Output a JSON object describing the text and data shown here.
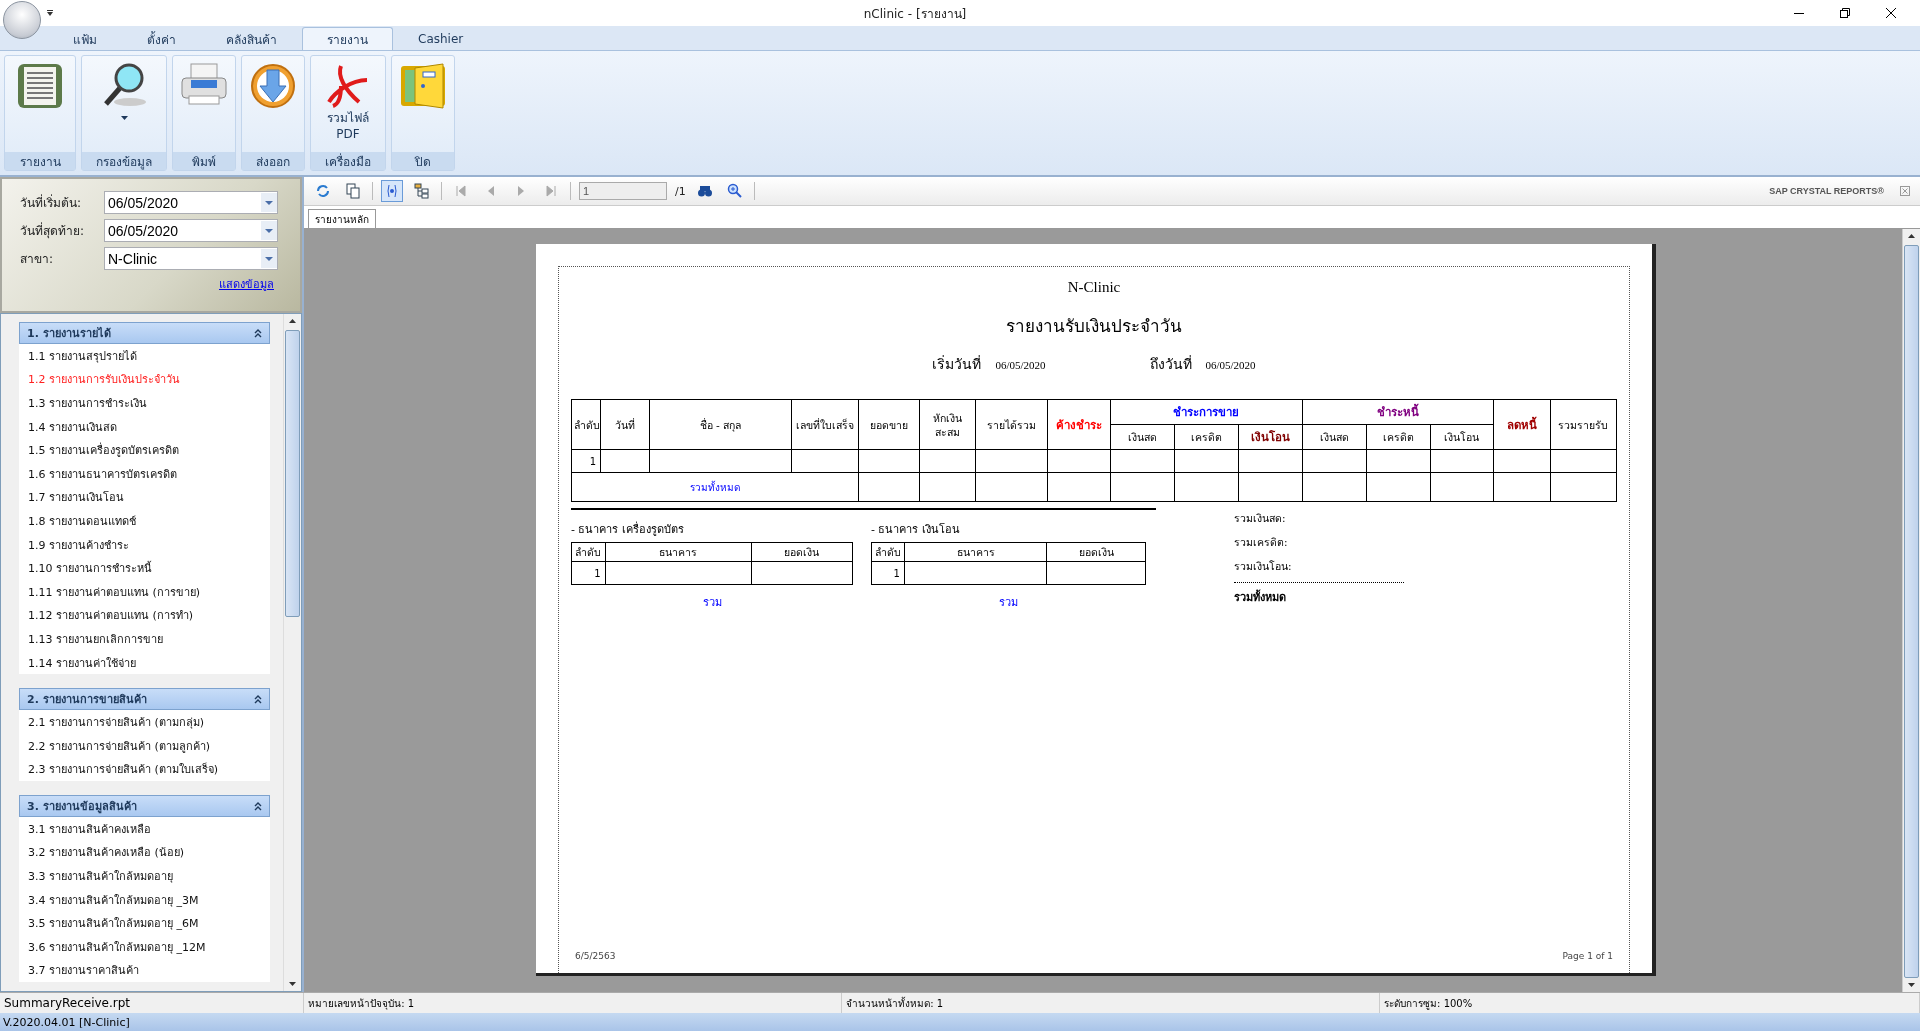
{
  "window": {
    "title": "nClinic - [รายงาน]"
  },
  "ribbon_tabs": [
    {
      "label": "แฟ้ม",
      "selected": false
    },
    {
      "label": "ตั้งค่า",
      "selected": false
    },
    {
      "label": "คลังสินค้า",
      "selected": false
    },
    {
      "label": "รายงาน",
      "selected": true
    },
    {
      "label": "Cashier",
      "selected": false
    }
  ],
  "ribbon_groups": [
    {
      "label": "รายงาน",
      "kind": "report"
    },
    {
      "label": "กรองข้อมูล",
      "kind": "magnifier",
      "dropdown": true
    },
    {
      "label": "พิมพ์",
      "kind": "printer"
    },
    {
      "label": "ส่งออก",
      "kind": "export"
    },
    {
      "label": "เครื่องมือ",
      "kind": "pdf",
      "button_label": [
        "รวมไฟล์",
        "PDF"
      ]
    },
    {
      "label": "ปิด",
      "kind": "exit"
    }
  ],
  "filters": [
    {
      "label": "วันที่เริ่มต้น:",
      "value": "06/05/2020"
    },
    {
      "label": "วันที่สุดท้าย:",
      "value": "06/05/2020"
    },
    {
      "label": "สาขา:",
      "value": "N-Clinic"
    }
  ],
  "show_link": "แสดงข้อมูล",
  "sections": [
    {
      "title": "1. รายงานรายได้",
      "expanded": true,
      "items": [
        {
          "label": "1.1  รายงานสรุปรายได้",
          "selected": false
        },
        {
          "label": "1.2  รายงานการรับเงินประจำวัน",
          "selected": true
        },
        {
          "label": "1.3  รายงานการชำระเงิน",
          "selected": false
        },
        {
          "label": "1.4  รายงานเงินสด",
          "selected": false
        },
        {
          "label": "1.5  รายงานเครื่องรูดบัตรเครดิต",
          "selected": false
        },
        {
          "label": "1.6  รายงานธนาคารบัตรเครดิต",
          "selected": false
        },
        {
          "label": "1.7  รายงานเงินโอน",
          "selected": false
        },
        {
          "label": "1.8  รายงานดอนแทดช์",
          "selected": false
        },
        {
          "label": "1.9  รายงานค้างชำระ",
          "selected": false
        },
        {
          "label": "1.10  รายงานการชำระหนี้",
          "selected": false
        },
        {
          "label": "1.11  รายงานค่าตอบแทน (การขาย)",
          "selected": false
        },
        {
          "label": "1.12  รายงานค่าตอบแทน (การทำ)",
          "selected": false
        },
        {
          "label": "1.13  รายงานยกเลิกการขาย",
          "selected": false
        },
        {
          "label": "1.14  รายงานค่าใช้จ่าย",
          "selected": false
        }
      ]
    },
    {
      "title": "2. รายงานการขายสินค้า",
      "expanded": true,
      "items": [
        {
          "label": "2.1 รายงานการจ่ายสินค้า (ตามกลุ่ม)",
          "selected": false
        },
        {
          "label": "2.2 รายงานการจ่ายสินค้า (ตามลูกค้า)",
          "selected": false
        },
        {
          "label": "2.3 รายงานการจ่ายสินค้า (ตามใบเสร็จ)",
          "selected": false
        }
      ]
    },
    {
      "title": "3. รายงานข้อมูลสินค้า",
      "expanded": true,
      "items": [
        {
          "label": "3.1 รายงานสินค้าคงเหลือ",
          "selected": false
        },
        {
          "label": "3.2 รายงานสินค้าคงเหลือ (น้อย)",
          "selected": false
        },
        {
          "label": "3.3 รายงานสินค้าใกล้หมดอายุ",
          "selected": false
        },
        {
          "label": "3.4 รายงานสินค้าใกล้หมดอายุ _3M",
          "selected": false
        },
        {
          "label": "3.5 รายงานสินค้าใกล้หมดอายุ _6M",
          "selected": false
        },
        {
          "label": "3.6 รายงานสินค้าใกล้หมดอายุ _12M",
          "selected": false
        },
        {
          "label": "3.7 รายงานราคาสินค้า",
          "selected": false
        }
      ]
    }
  ],
  "viewer_toolbar": {
    "page_field": "1",
    "page_total": "/1",
    "brand": "SAP CRYSTAL REPORTS®"
  },
  "viewer_tab": "รายงานหลัก",
  "report": {
    "company": "N-Clinic",
    "title": "รายงานรับเงินประจำวัน",
    "date_from_label": "เริ่มวันที่",
    "date_from": "06/05/2020",
    "date_to_label": "ถึงวันที่",
    "date_to": "06/05/2020",
    "columns": [
      {
        "label": "ลำดับ"
      },
      {
        "label": "วันที่"
      },
      {
        "label": "ชื่อ - สกุล"
      },
      {
        "label": "เลขที่ใบเสร็จ"
      },
      {
        "label": "ยอดขาย"
      },
      {
        "label": "หักเงินสะสม"
      },
      {
        "label": "รายได้รวม"
      },
      {
        "label": "ค้างชำระ",
        "color": "#ff0000"
      },
      {
        "label": "ชำระการขาย",
        "color": "#0000ff",
        "children": [
          {
            "label": "เงินสด"
          },
          {
            "label": "เครดิต"
          },
          {
            "label": "เงินโอน",
            "color": "#800000"
          }
        ]
      },
      {
        "label": "ชำระหนี้",
        "color": "#800080",
        "children": [
          {
            "label": "เงินสด"
          },
          {
            "label": "เครดิต"
          },
          {
            "label": "เงินโอน"
          }
        ]
      },
      {
        "label": "ลดหนี้",
        "color": "#a00000"
      },
      {
        "label": "รวมรายรับ"
      }
    ],
    "rows": [
      {
        "number": "1"
      }
    ],
    "total_label": "รวมทั้งหมด",
    "bank_tables": [
      {
        "title": "- ธนาคาร เครื่องรูดบัตร",
        "columns": [
          "ลำดับ",
          "ธนาคาร",
          "ยอดเงิน"
        ],
        "rows": [
          {
            "number": "1"
          }
        ],
        "total_label": "รวม"
      },
      {
        "title": "- ธนาคาร เงินโอน",
        "columns": [
          "ลำดับ",
          "ธนาคาร",
          "ยอดเงิน"
        ],
        "rows": [
          {
            "number": "1"
          }
        ],
        "total_label": "รวม"
      }
    ],
    "summary": [
      "รวมเงินสด:",
      "รวมเครดิต:",
      "รวมเงินโอน:"
    ],
    "summary_total": "รวมทั้งหมด",
    "footer_left": "6/5/2563",
    "footer_right": "Page 1 of 1"
  },
  "status_bar": [
    "SummaryReceive.rpt",
    "หมายเลขหน้าปัจจุบัน: 1",
    "จำนวนหน้าทั้งหมด: 1",
    "ระดับการซูม: 100%"
  ],
  "version": "V.2020.04.01 [N-Clinic]"
}
